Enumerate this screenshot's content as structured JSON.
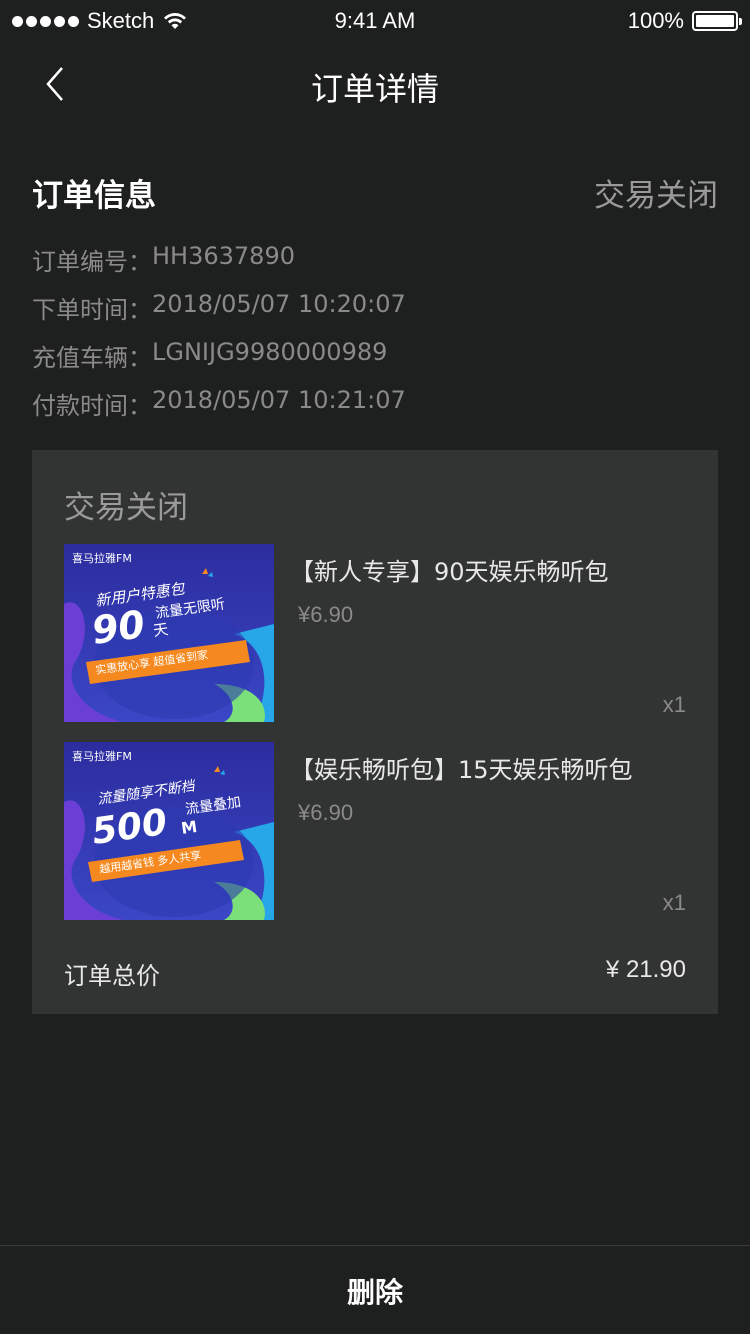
{
  "status_bar": {
    "carrier": "Sketch",
    "time": "9:41 AM",
    "battery": "100%"
  },
  "nav": {
    "title": "订单详情",
    "back_icon": "chevron-left-icon"
  },
  "order_info": {
    "section_title": "订单信息",
    "status": "交易关闭",
    "rows": [
      {
        "label": "订单编号：",
        "value": "HH3637890"
      },
      {
        "label": "下单时间：",
        "value": "2018/05/07 10:20:07"
      },
      {
        "label": "充值车辆：",
        "value": "LGNIJG9980000989"
      },
      {
        "label": "付款时间：",
        "value": "2018/05/07 10:21:07"
      }
    ]
  },
  "card": {
    "title": "交易关闭",
    "items": [
      {
        "name": "【新人专享】90天娱乐畅听包",
        "price": "¥6.90",
        "qty": "x1",
        "thumb": {
          "brand": "喜马拉雅FM",
          "line1": "新用户特惠包",
          "big": "90",
          "unit": "天",
          "tag": "流量无限听",
          "ribbon": "实惠放心享   超值省到家"
        }
      },
      {
        "name": "【娱乐畅听包】15天娱乐畅听包",
        "price": "¥6.90",
        "qty": "x1",
        "thumb": {
          "brand": "喜马拉雅FM",
          "line1": "流量随享不断档",
          "big": "500",
          "unit": "M",
          "tag": "流量叠加",
          "ribbon": "越用越省钱   多人共享"
        }
      }
    ],
    "total_label": "订单总价",
    "total_value": "¥ 21.90"
  },
  "bottom": {
    "delete_label": "删除"
  },
  "colors": {
    "background": "#1e1f1f",
    "card": "#323333",
    "muted_text": "#8a8a8a",
    "banner_blue": "#2f35a8",
    "banner_orange": "#f5891f"
  }
}
